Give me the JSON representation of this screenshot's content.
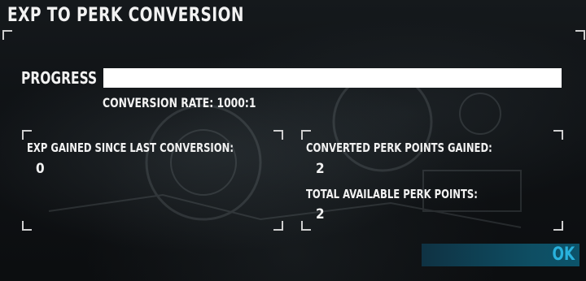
{
  "dialog": {
    "title": "EXP TO PERK CONVERSION"
  },
  "progress": {
    "label": "PROGRESS",
    "fraction": 1.0,
    "conversion_rate": "CONVERSION RATE: 1000:1"
  },
  "left_panel": {
    "exp_gained_label": "EXP GAINED SINCE LAST CONVERSION:",
    "exp_gained_value": "0"
  },
  "right_panel": {
    "converted_label": "CONVERTED PERK POINTS GAINED:",
    "converted_value": "2",
    "total_label": "TOTAL AVAILABLE PERK POINTS:",
    "total_value": "2"
  },
  "actions": {
    "ok_label": "OK"
  },
  "colors": {
    "accent": "#29b2dd",
    "button_bg": "#0e4e63",
    "progress_fill": "#ffffff",
    "text": "#f2f2f2"
  }
}
